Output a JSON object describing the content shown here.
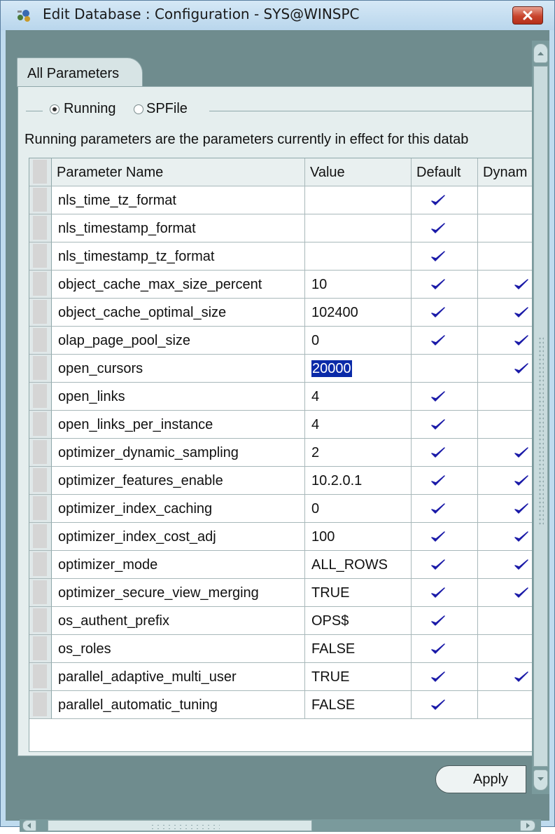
{
  "window": {
    "title": "Edit Database : Configuration - SYS@WINSPC"
  },
  "tabs": [
    {
      "label": "All Parameters"
    }
  ],
  "mode": {
    "running_label": "Running",
    "spfile_label": "SPFile",
    "selected": "Running"
  },
  "description": "Running parameters are the parameters currently in effect for this datab",
  "table": {
    "columns": [
      "Parameter Name",
      "Value",
      "Default",
      "Dynam"
    ],
    "rows": [
      {
        "name": "nls_time_tz_format",
        "value": "",
        "default": true,
        "dynamic": false
      },
      {
        "name": "nls_timestamp_format",
        "value": "",
        "default": true,
        "dynamic": false
      },
      {
        "name": "nls_timestamp_tz_format",
        "value": "",
        "default": true,
        "dynamic": false
      },
      {
        "name": "object_cache_max_size_percent",
        "value": "10",
        "default": true,
        "dynamic": true
      },
      {
        "name": "object_cache_optimal_size",
        "value": "102400",
        "default": true,
        "dynamic": true
      },
      {
        "name": "olap_page_pool_size",
        "value": "0",
        "default": true,
        "dynamic": true
      },
      {
        "name": "open_cursors",
        "value": "20000",
        "default": false,
        "dynamic": true,
        "selected": true
      },
      {
        "name": "open_links",
        "value": "4",
        "default": true,
        "dynamic": false
      },
      {
        "name": "open_links_per_instance",
        "value": "4",
        "default": true,
        "dynamic": false
      },
      {
        "name": "optimizer_dynamic_sampling",
        "value": "2",
        "default": true,
        "dynamic": true
      },
      {
        "name": "optimizer_features_enable",
        "value": "10.2.0.1",
        "default": true,
        "dynamic": true
      },
      {
        "name": "optimizer_index_caching",
        "value": "0",
        "default": true,
        "dynamic": true
      },
      {
        "name": "optimizer_index_cost_adj",
        "value": "100",
        "default": true,
        "dynamic": true
      },
      {
        "name": "optimizer_mode",
        "value": "ALL_ROWS",
        "default": true,
        "dynamic": true
      },
      {
        "name": "optimizer_secure_view_merging",
        "value": "TRUE",
        "default": true,
        "dynamic": true
      },
      {
        "name": "os_authent_prefix",
        "value": "OPS$",
        "default": true,
        "dynamic": false
      },
      {
        "name": "os_roles",
        "value": "FALSE",
        "default": true,
        "dynamic": false
      },
      {
        "name": "parallel_adaptive_multi_user",
        "value": "TRUE",
        "default": true,
        "dynamic": true
      },
      {
        "name": "parallel_automatic_tuning",
        "value": "FALSE",
        "default": true,
        "dynamic": false
      }
    ]
  },
  "buttons": {
    "apply_label": "Apply"
  },
  "colors": {
    "check": "#1a1aa8",
    "selection": "#0a2aa8",
    "client_bg": "#6f8c8e"
  }
}
